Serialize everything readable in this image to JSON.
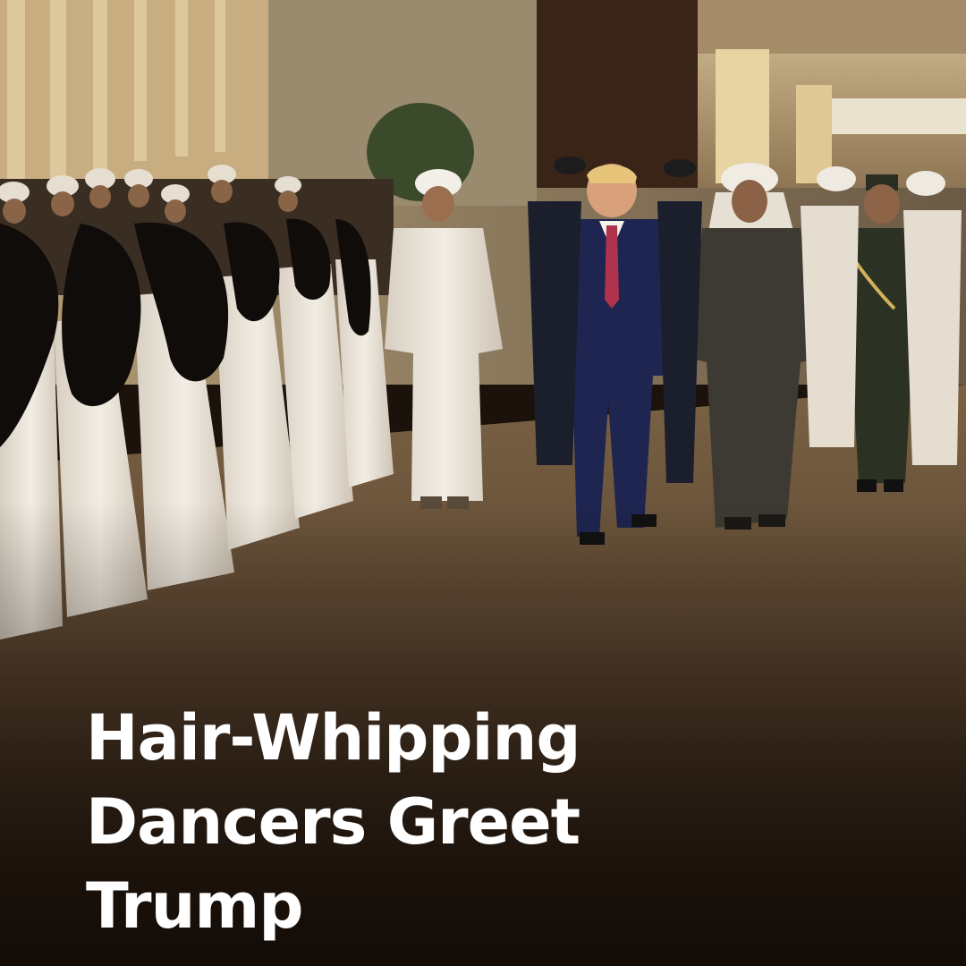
{
  "headline": {
    "lines": [
      "Hair-Whipping",
      "Dancers Greet",
      "Trump"
    ]
  },
  "colors": {
    "headline_text": "#ffffff",
    "floor": "#6b5235",
    "bottom_shade": "#140d07",
    "white_robe": "#efe9df",
    "navy_suit": "#1d2550",
    "red_tie": "#b0334d",
    "dark_robe": "#3d3a33",
    "military_uniform": "#2c3223",
    "hair": "#0f0c0a"
  }
}
